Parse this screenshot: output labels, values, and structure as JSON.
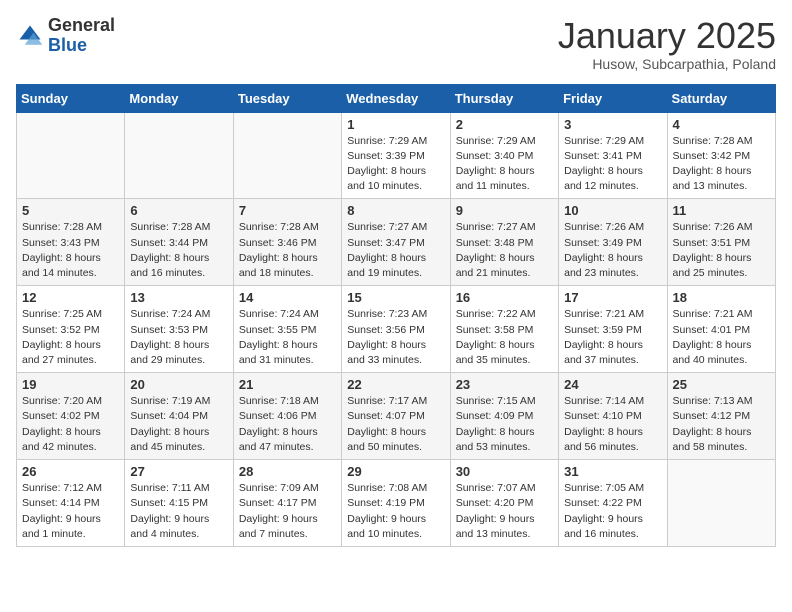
{
  "logo": {
    "general": "General",
    "blue": "Blue"
  },
  "title": "January 2025",
  "subtitle": "Husow, Subcarpathia, Poland",
  "days_header": [
    "Sunday",
    "Monday",
    "Tuesday",
    "Wednesday",
    "Thursday",
    "Friday",
    "Saturday"
  ],
  "weeks": [
    [
      {
        "day": "",
        "info": ""
      },
      {
        "day": "",
        "info": ""
      },
      {
        "day": "",
        "info": ""
      },
      {
        "day": "1",
        "info": "Sunrise: 7:29 AM\nSunset: 3:39 PM\nDaylight: 8 hours\nand 10 minutes."
      },
      {
        "day": "2",
        "info": "Sunrise: 7:29 AM\nSunset: 3:40 PM\nDaylight: 8 hours\nand 11 minutes."
      },
      {
        "day": "3",
        "info": "Sunrise: 7:29 AM\nSunset: 3:41 PM\nDaylight: 8 hours\nand 12 minutes."
      },
      {
        "day": "4",
        "info": "Sunrise: 7:28 AM\nSunset: 3:42 PM\nDaylight: 8 hours\nand 13 minutes."
      }
    ],
    [
      {
        "day": "5",
        "info": "Sunrise: 7:28 AM\nSunset: 3:43 PM\nDaylight: 8 hours\nand 14 minutes."
      },
      {
        "day": "6",
        "info": "Sunrise: 7:28 AM\nSunset: 3:44 PM\nDaylight: 8 hours\nand 16 minutes."
      },
      {
        "day": "7",
        "info": "Sunrise: 7:28 AM\nSunset: 3:46 PM\nDaylight: 8 hours\nand 18 minutes."
      },
      {
        "day": "8",
        "info": "Sunrise: 7:27 AM\nSunset: 3:47 PM\nDaylight: 8 hours\nand 19 minutes."
      },
      {
        "day": "9",
        "info": "Sunrise: 7:27 AM\nSunset: 3:48 PM\nDaylight: 8 hours\nand 21 minutes."
      },
      {
        "day": "10",
        "info": "Sunrise: 7:26 AM\nSunset: 3:49 PM\nDaylight: 8 hours\nand 23 minutes."
      },
      {
        "day": "11",
        "info": "Sunrise: 7:26 AM\nSunset: 3:51 PM\nDaylight: 8 hours\nand 25 minutes."
      }
    ],
    [
      {
        "day": "12",
        "info": "Sunrise: 7:25 AM\nSunset: 3:52 PM\nDaylight: 8 hours\nand 27 minutes."
      },
      {
        "day": "13",
        "info": "Sunrise: 7:24 AM\nSunset: 3:53 PM\nDaylight: 8 hours\nand 29 minutes."
      },
      {
        "day": "14",
        "info": "Sunrise: 7:24 AM\nSunset: 3:55 PM\nDaylight: 8 hours\nand 31 minutes."
      },
      {
        "day": "15",
        "info": "Sunrise: 7:23 AM\nSunset: 3:56 PM\nDaylight: 8 hours\nand 33 minutes."
      },
      {
        "day": "16",
        "info": "Sunrise: 7:22 AM\nSunset: 3:58 PM\nDaylight: 8 hours\nand 35 minutes."
      },
      {
        "day": "17",
        "info": "Sunrise: 7:21 AM\nSunset: 3:59 PM\nDaylight: 8 hours\nand 37 minutes."
      },
      {
        "day": "18",
        "info": "Sunrise: 7:21 AM\nSunset: 4:01 PM\nDaylight: 8 hours\nand 40 minutes."
      }
    ],
    [
      {
        "day": "19",
        "info": "Sunrise: 7:20 AM\nSunset: 4:02 PM\nDaylight: 8 hours\nand 42 minutes."
      },
      {
        "day": "20",
        "info": "Sunrise: 7:19 AM\nSunset: 4:04 PM\nDaylight: 8 hours\nand 45 minutes."
      },
      {
        "day": "21",
        "info": "Sunrise: 7:18 AM\nSunset: 4:06 PM\nDaylight: 8 hours\nand 47 minutes."
      },
      {
        "day": "22",
        "info": "Sunrise: 7:17 AM\nSunset: 4:07 PM\nDaylight: 8 hours\nand 50 minutes."
      },
      {
        "day": "23",
        "info": "Sunrise: 7:15 AM\nSunset: 4:09 PM\nDaylight: 8 hours\nand 53 minutes."
      },
      {
        "day": "24",
        "info": "Sunrise: 7:14 AM\nSunset: 4:10 PM\nDaylight: 8 hours\nand 56 minutes."
      },
      {
        "day": "25",
        "info": "Sunrise: 7:13 AM\nSunset: 4:12 PM\nDaylight: 8 hours\nand 58 minutes."
      }
    ],
    [
      {
        "day": "26",
        "info": "Sunrise: 7:12 AM\nSunset: 4:14 PM\nDaylight: 9 hours\nand 1 minute."
      },
      {
        "day": "27",
        "info": "Sunrise: 7:11 AM\nSunset: 4:15 PM\nDaylight: 9 hours\nand 4 minutes."
      },
      {
        "day": "28",
        "info": "Sunrise: 7:09 AM\nSunset: 4:17 PM\nDaylight: 9 hours\nand 7 minutes."
      },
      {
        "day": "29",
        "info": "Sunrise: 7:08 AM\nSunset: 4:19 PM\nDaylight: 9 hours\nand 10 minutes."
      },
      {
        "day": "30",
        "info": "Sunrise: 7:07 AM\nSunset: 4:20 PM\nDaylight: 9 hours\nand 13 minutes."
      },
      {
        "day": "31",
        "info": "Sunrise: 7:05 AM\nSunset: 4:22 PM\nDaylight: 9 hours\nand 16 minutes."
      },
      {
        "day": "",
        "info": ""
      }
    ]
  ]
}
